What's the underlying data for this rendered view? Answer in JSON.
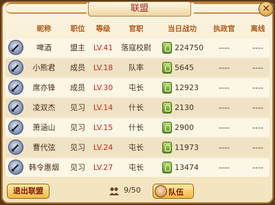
{
  "window": {
    "title": "联盟",
    "close_symbol": "✕"
  },
  "columns": [
    "昵称",
    "职位",
    "等级",
    "官职",
    "当日战功",
    "执政官",
    "离线"
  ],
  "members": [
    {
      "name": "啤酒",
      "position": "盟主",
      "level": "LV.41",
      "office": "落寇校尉",
      "merit": "224750",
      "consul": "----",
      "offline": "----"
    },
    {
      "name": "小熊君",
      "position": "成员",
      "level": "LV.18",
      "office": "队率",
      "merit": "5645",
      "consul": "----",
      "offline": "----"
    },
    {
      "name": "席亦锋",
      "position": "成员",
      "level": "LV.30",
      "office": "屯长",
      "merit": "12923",
      "consul": "----",
      "offline": "----"
    },
    {
      "name": "凌双杰",
      "position": "见习",
      "level": "LV.14",
      "office": "什长",
      "merit": "2130",
      "consul": "----",
      "offline": "----"
    },
    {
      "name": "萧涵山",
      "position": "见习",
      "level": "LV.15",
      "office": "什长",
      "merit": "2900",
      "consul": "----",
      "offline": "----"
    },
    {
      "name": "曹代弦",
      "position": "见习",
      "level": "LV.24",
      "office": "屯长",
      "merit": "11973",
      "consul": "----",
      "offline": "----"
    },
    {
      "name": "韩令惠烟",
      "position": "见习",
      "level": "LV.27",
      "office": "屯长",
      "merit": "13474",
      "consul": "----",
      "offline": "----"
    }
  ],
  "footer": {
    "quit_label": "退出联盟",
    "member_count": "9/50",
    "team_label": "队伍"
  },
  "colors": {
    "accent": "#a32020",
    "level": "#c8281e",
    "header": "#b15a1c"
  }
}
